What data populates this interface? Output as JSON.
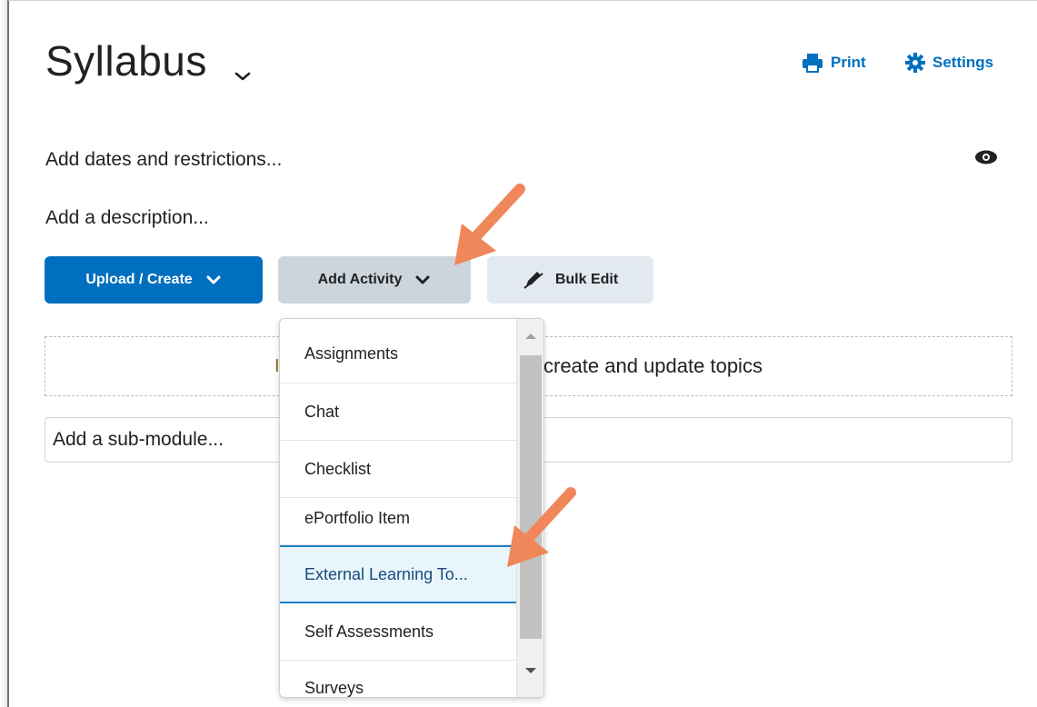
{
  "header": {
    "title": "Syllabus",
    "print_label": "Print",
    "settings_label": "Settings"
  },
  "module": {
    "dates_text": "Add dates and restrictions...",
    "description_text": "Add a description...",
    "dropzone_text": "create and update topics",
    "dropzone_fragment": "I",
    "submodule_placeholder": "Add a sub-module..."
  },
  "toolbar": {
    "upload_label": "Upload / Create",
    "add_activity_label": "Add Activity",
    "bulk_edit_label": "Bulk Edit"
  },
  "activity_menu": {
    "items": [
      {
        "label": "Assignments"
      },
      {
        "label": "Chat"
      },
      {
        "label": "Checklist"
      },
      {
        "label": "ePortfolio Item"
      },
      {
        "label": "External Learning To..."
      },
      {
        "label": "Self Assessments"
      },
      {
        "label": "Surveys"
      }
    ],
    "highlighted_index": 4
  },
  "colors": {
    "primary": "#006fbf",
    "secondary_button": "#cdd5dc",
    "tertiary_button": "#e3e9f1",
    "highlight_bg": "#e8f5fb",
    "highlight_border": "#1c7fc4",
    "annotation_arrow": "#f0875a"
  },
  "icons": {
    "print": "printer-icon",
    "settings": "gear-icon",
    "visibility": "eye-icon",
    "title_chevron": "chevron-down-icon",
    "bulk_edit": "pencil-icon"
  }
}
